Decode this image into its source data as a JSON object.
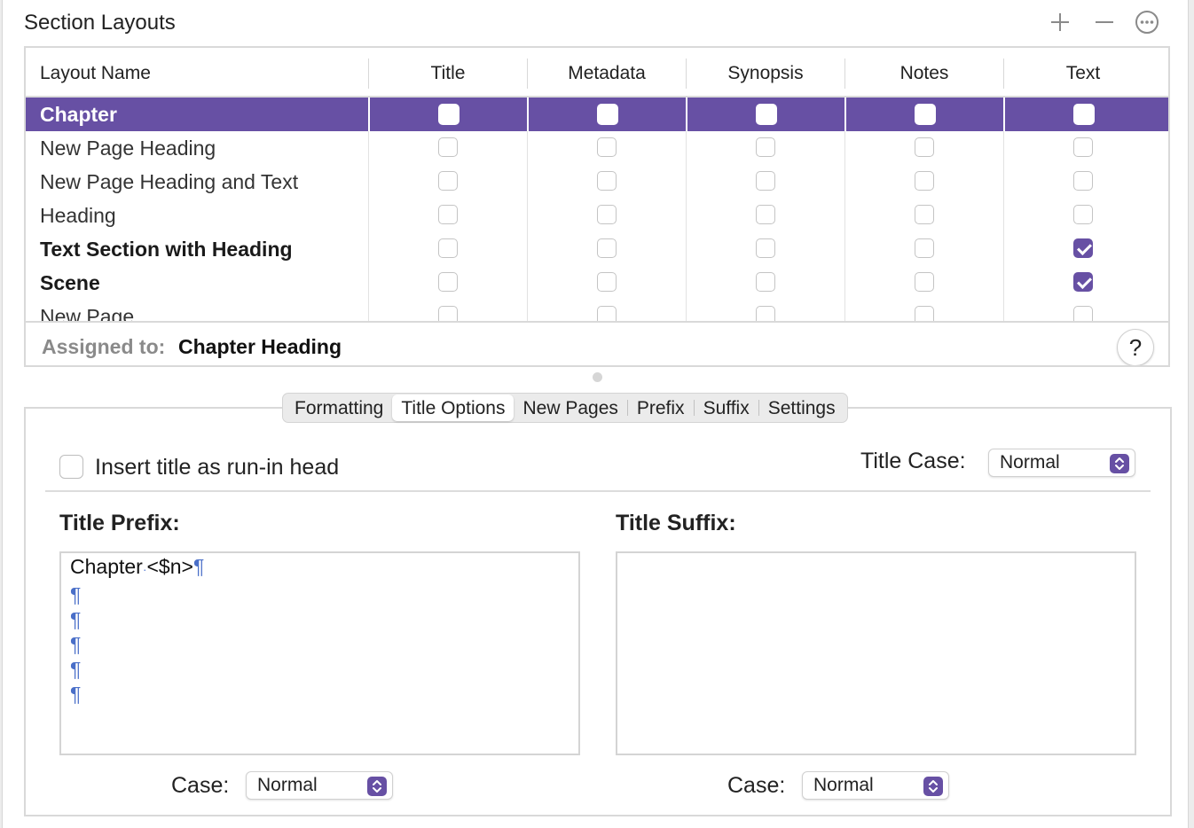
{
  "header": {
    "title": "Section Layouts"
  },
  "icons": {
    "add": "plus-icon",
    "remove": "minus-icon",
    "more": "ellipsis-circle-icon"
  },
  "table": {
    "columns": [
      "Layout Name",
      "Title",
      "Metadata",
      "Synopsis",
      "Notes",
      "Text"
    ],
    "rows": [
      {
        "name": "Chapter",
        "bold": true,
        "selected": true,
        "checks": [
          false,
          false,
          false,
          false,
          false
        ]
      },
      {
        "name": "New Page Heading",
        "bold": false,
        "selected": false,
        "checks": [
          false,
          false,
          false,
          false,
          false
        ]
      },
      {
        "name": "New Page Heading and Text",
        "bold": false,
        "selected": false,
        "checks": [
          false,
          false,
          false,
          false,
          false
        ]
      },
      {
        "name": "Heading",
        "bold": false,
        "selected": false,
        "checks": [
          false,
          false,
          false,
          false,
          false
        ]
      },
      {
        "name": "Text Section with Heading",
        "bold": true,
        "selected": false,
        "checks": [
          false,
          false,
          false,
          false,
          true
        ]
      },
      {
        "name": "Scene",
        "bold": true,
        "selected": false,
        "checks": [
          false,
          false,
          false,
          false,
          true
        ]
      },
      {
        "name": "New Page",
        "bold": false,
        "selected": false,
        "checks": [
          false,
          false,
          false,
          false,
          false
        ]
      }
    ]
  },
  "assigned": {
    "label": "Assigned to:",
    "value": "Chapter Heading",
    "help": "?"
  },
  "tabs": {
    "items": [
      "Formatting",
      "Title Options",
      "New Pages",
      "Prefix",
      "Suffix",
      "Settings"
    ],
    "active": "Title Options"
  },
  "title_options": {
    "runin_label": "Insert title as run-in head",
    "runin_checked": false,
    "title_case_label": "Title Case:",
    "title_case_value": "Normal",
    "prefix_label": "Title Prefix:",
    "suffix_label": "Title Suffix:",
    "prefix_lines": [
      "Chapter",
      "<$n>"
    ],
    "pilcrow": "¶",
    "suffix_text": "",
    "case_label": "Case:",
    "prefix_case_value": "Normal",
    "suffix_case_value": "Normal"
  },
  "colors": {
    "accent": "#6750a4",
    "pilcrow": "#4a6fc8"
  }
}
